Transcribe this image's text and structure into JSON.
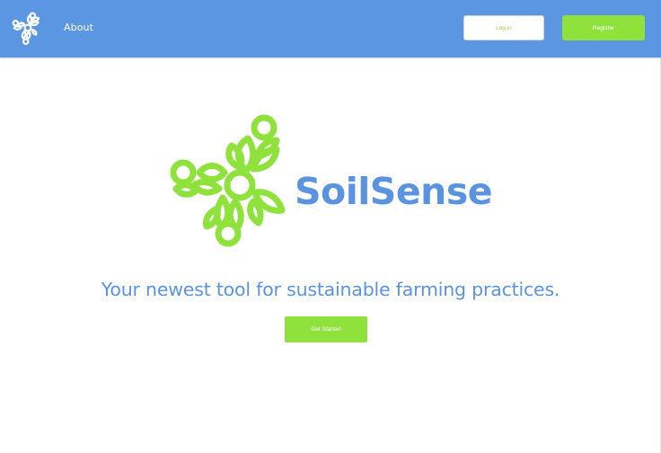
{
  "navbar": {
    "logo_icon": "leaf-flower-logo-icon",
    "about_label": "About",
    "login_label": "Log in",
    "register_label": "Register"
  },
  "hero": {
    "logo_icon": "leaf-flower-logo-icon",
    "brand_name": "SoilSense",
    "tagline": "Your newest tool for sustainable farming practices.",
    "cta_label": "Get Started"
  },
  "colors": {
    "nav_background": "#5b96e2",
    "brand_blue": "#5a93e0",
    "accent_green": "#8fe23c",
    "page_background": "#ffffff"
  }
}
